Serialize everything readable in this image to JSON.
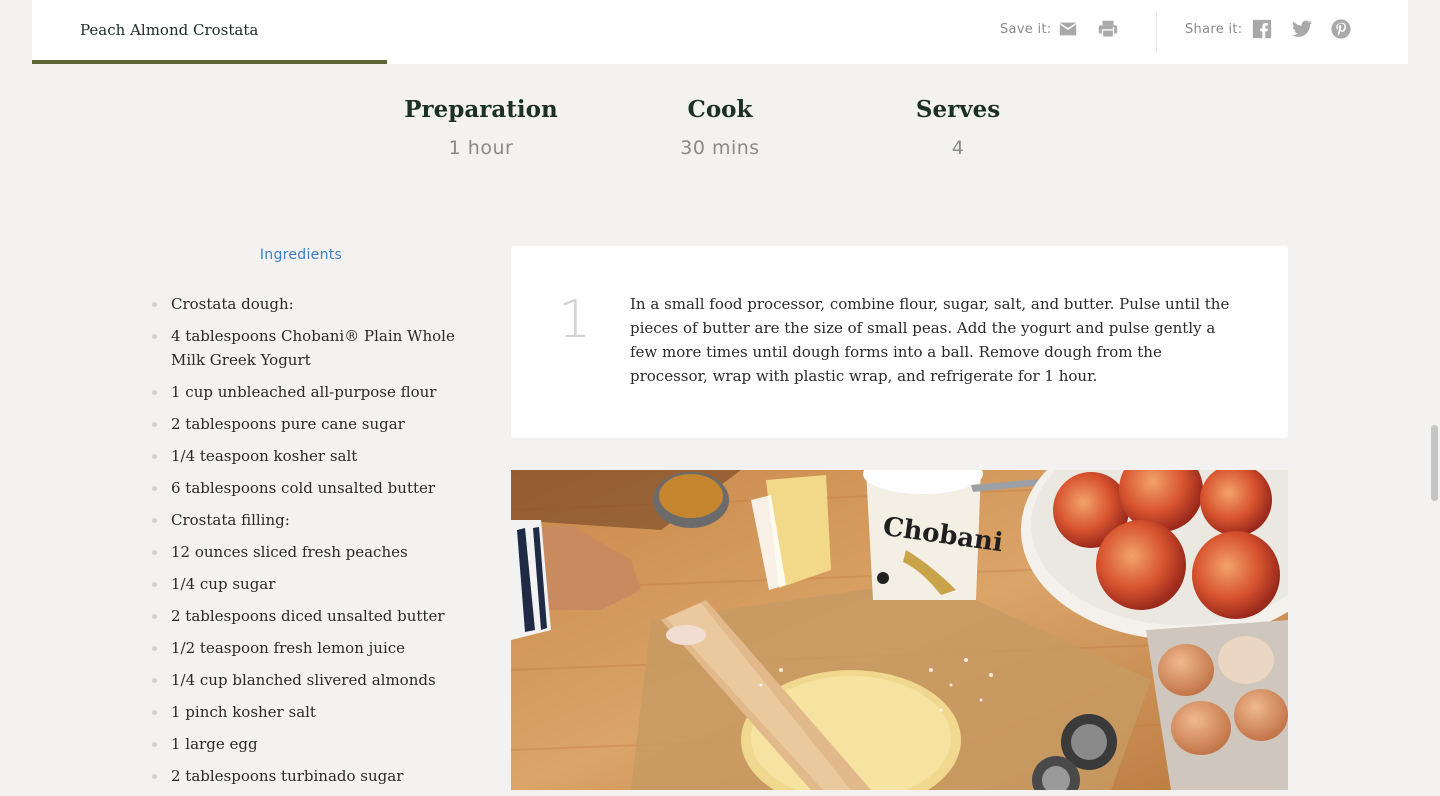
{
  "header": {
    "recipe_title": "Peach Almond Crostata",
    "save_label": "Save it:",
    "share_label": "Share it:",
    "icons": [
      "mail-icon",
      "print-icon",
      "facebook-icon",
      "twitter-icon",
      "pinterest-icon"
    ]
  },
  "stats": [
    {
      "label": "Preparation",
      "value": "1 hour"
    },
    {
      "label": "Cook",
      "value": "30 mins"
    },
    {
      "label": "Serves",
      "value": "4"
    }
  ],
  "ingredients": {
    "heading": "Ingredients",
    "items": [
      "Crostata dough:",
      "4 tablespoons Chobani® Plain Whole Milk Greek Yogurt",
      "1 cup unbleached all-purpose flour",
      "2 tablespoons pure cane sugar",
      "1/4 teaspoon kosher salt",
      "6 tablespoons cold unsalted butter",
      "Crostata filling:",
      "12 ounces sliced fresh peaches",
      "1/4 cup sugar",
      "2 tablespoons diced unsalted butter",
      "1/2 teaspoon fresh lemon juice",
      "1/4 cup blanched slivered almonds",
      "1 pinch kosher salt",
      "1 large egg",
      "2 tablespoons turbinado sugar"
    ]
  },
  "step": {
    "number": "1",
    "text": "In a small food processor, combine flour, sugar, salt, and butter. Pulse until the pieces of butter are the size of small peas. Add the yogurt and pulse gently a few more times until dough forms into a ball. Remove dough from the processor, wrap with plastic wrap, and refrigerate for 1 hour."
  },
  "photo": {
    "yogurt_brand": "Chobani"
  },
  "colors": {
    "accent_olive": "#5d6531",
    "heading_green": "#1c3028",
    "link_blue": "#3a7fc4",
    "icon_gray": "#a9a9a9"
  }
}
